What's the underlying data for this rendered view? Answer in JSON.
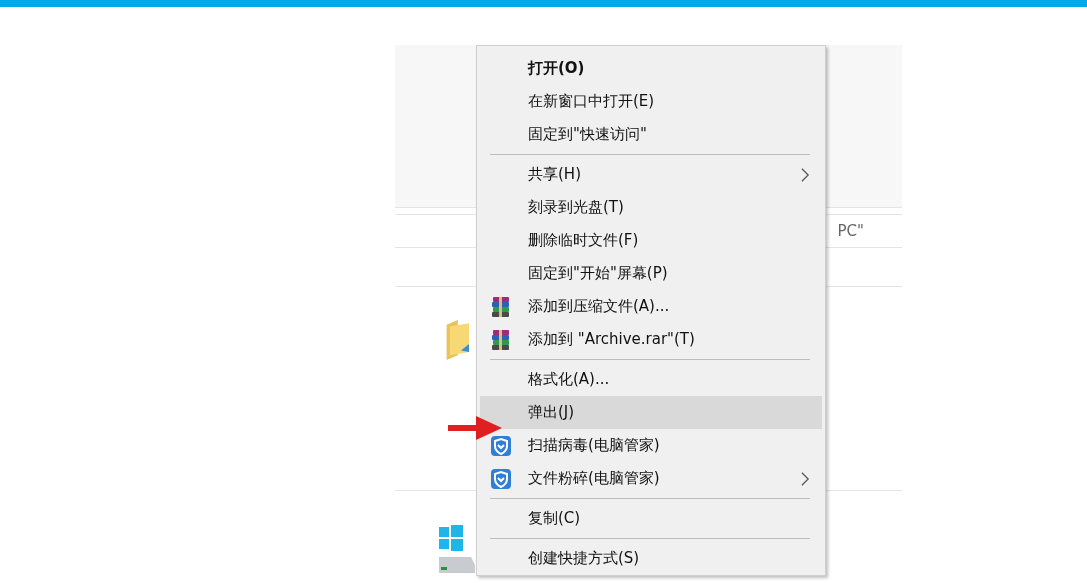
{
  "address_bar": {
    "text": "PC\""
  },
  "context_menu": {
    "items": [
      {
        "kind": "item",
        "label": "打开(O)",
        "default": true,
        "selected": false
      },
      {
        "kind": "item",
        "label": "在新窗口中打开(E)",
        "selected": false
      },
      {
        "kind": "item",
        "label": "固定到\"快速访问\"",
        "selected": false
      },
      {
        "kind": "separator"
      },
      {
        "kind": "item",
        "label": "共享(H)",
        "submenu": true,
        "selected": false
      },
      {
        "kind": "item",
        "label": "刻录到光盘(T)",
        "selected": false
      },
      {
        "kind": "item",
        "label": "删除临时文件(F)",
        "selected": false
      },
      {
        "kind": "item",
        "label": "固定到\"开始\"屏幕(P)",
        "selected": false
      },
      {
        "kind": "archive",
        "label": "添加到压缩文件(A)...",
        "selected": false
      },
      {
        "kind": "archive",
        "label": "添加到 \"Archive.rar\"(T)",
        "selected": false
      },
      {
        "kind": "separator"
      },
      {
        "kind": "item",
        "label": "格式化(A)...",
        "selected": false
      },
      {
        "kind": "item",
        "label": "弹出(J)",
        "selected": true
      },
      {
        "kind": "shield",
        "label": "扫描病毒(电脑管家)",
        "selected": false
      },
      {
        "kind": "shield",
        "label": "文件粉碎(电脑管家)",
        "submenu": true,
        "selected": false
      },
      {
        "kind": "separator"
      },
      {
        "kind": "item",
        "label": "复制(C)",
        "selected": false
      },
      {
        "kind": "separator"
      },
      {
        "kind": "item",
        "label": "创建快捷方式(S)",
        "selected": false
      }
    ]
  }
}
